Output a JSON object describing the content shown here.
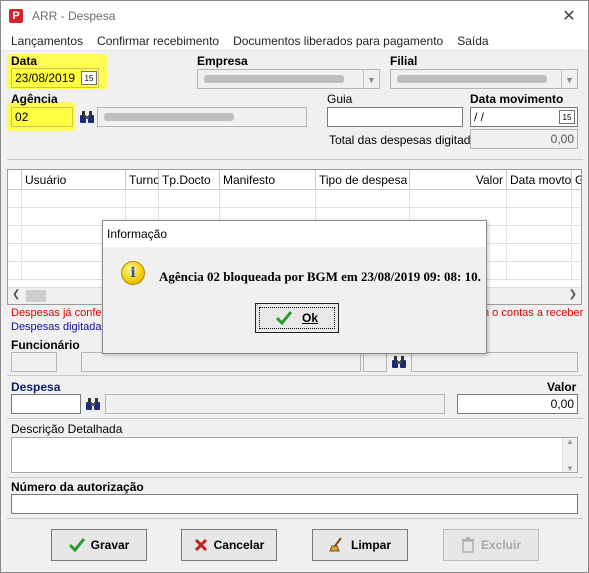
{
  "window": {
    "title": "ARR - Despesa",
    "close_label": "✕"
  },
  "menu": {
    "items": [
      "Lançamentos",
      "Confirmar recebimento",
      "Documentos liberados para pagamento",
      "Saída"
    ]
  },
  "header": {
    "data_label": "Data",
    "data_value": "23/08/2019",
    "empresa_label": "Empresa",
    "filial_label": "Filial",
    "agencia_label": "Agência",
    "agencia_value": "02",
    "guia_label": "Guia",
    "guia_value": "",
    "data_movimento_label": "Data movimento",
    "data_movimento_value": " /  /",
    "total_label": "Total das despesas digitadas",
    "total_value": "0,00",
    "calendar_glyph": "15"
  },
  "grid": {
    "columns": [
      "Usuário",
      "Turno",
      "Tp.Docto",
      "Manifesto",
      "Tipo de despesa",
      "Valor",
      "Data movto",
      "G"
    ]
  },
  "legend": {
    "red_text": "Despesas já confer",
    "red_text_right": "n o contas a receber",
    "blue_text": "Despesas digitada"
  },
  "funcionario": {
    "label": "Funcionário"
  },
  "despesa": {
    "label": "Despesa",
    "valor_label": "Valor",
    "valor_value": "0,00"
  },
  "descricao": {
    "label": "Descrição Detalhada"
  },
  "autorizacao": {
    "label": "Número da autorização"
  },
  "buttons": {
    "gravar": "Gravar",
    "cancelar": "Cancelar",
    "limpar": "Limpar",
    "excluir": "Excluir"
  },
  "dialog": {
    "title": "Informação",
    "message": "Agência 02 bloqueada por BGM em 23/08/2019 09: 08: 10.",
    "ok_label": "Ok",
    "icon": "information-icon"
  },
  "colors": {
    "highlight": "#fffd53",
    "red_text": "#e00000",
    "blue_text": "#1010a0",
    "check_green": "#2e9b2e",
    "x_red": "#c81e1e"
  }
}
